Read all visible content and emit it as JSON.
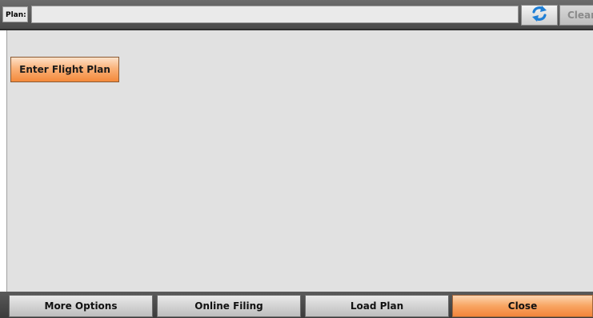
{
  "toolbar": {
    "plan_label": "Plan:",
    "plan_value": "",
    "plan_placeholder": "",
    "refresh_icon": "refresh-icon",
    "clear_label": "Clear"
  },
  "main": {
    "enter_flight_plan_label": "Enter Flight Plan"
  },
  "footer": {
    "more_options_label": "More Options",
    "online_filing_label": "Online Filing",
    "load_plan_label": "Load Plan",
    "close_label": "Close"
  },
  "colors": {
    "accent_orange": "#f4893a",
    "panel_gray": "#e1e1e1",
    "refresh_blue": "#1f7fd6"
  }
}
